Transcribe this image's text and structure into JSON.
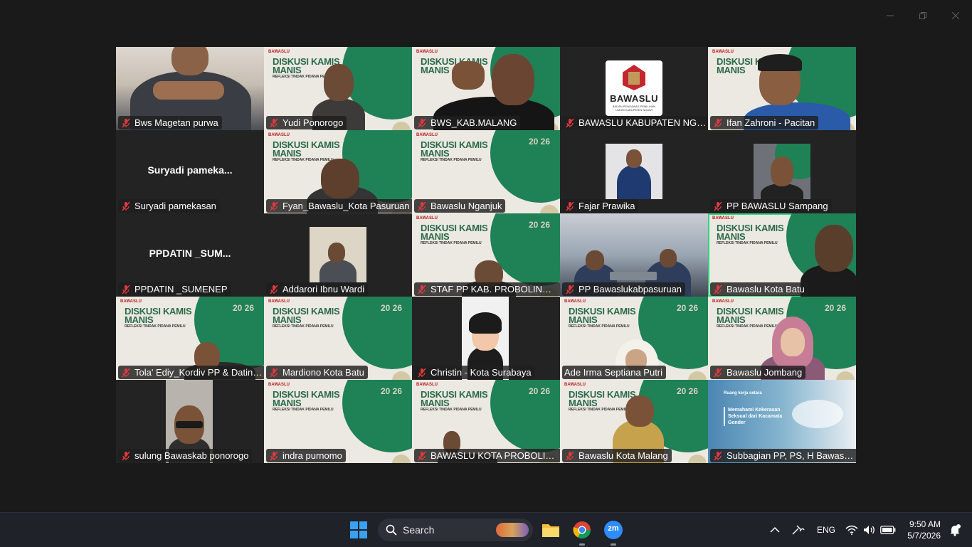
{
  "window": {
    "controls": [
      "minimize",
      "restore",
      "close"
    ]
  },
  "banner": {
    "logo": "BAWASLU",
    "title_line1": "DISKUSI KAMIS",
    "title_line2": "MANIS",
    "subtitle": "REFLEKSI TINDAK PIDANA PEMILU",
    "year": "20 26"
  },
  "logo_tile": {
    "name": "BAWASLU",
    "sub": "BADAN PENGAWAS PEMILIHAN UMUM KABUPATEN NGAWI"
  },
  "participants": [
    {
      "name": "Bws Magetan purwa"
    },
    {
      "name": "Yudi Ponorogo"
    },
    {
      "name": "BWS_KAB.MALANG"
    },
    {
      "name": "BAWASLU KABUPATEN NGAWI"
    },
    {
      "name": "Ifan Zahroni - Pacitan"
    },
    {
      "name": "Suryadi pamekasan",
      "big": "Suryadi  pameka..."
    },
    {
      "name": "Fyan_Bawaslu_Kota Pasuruan"
    },
    {
      "name": "Bawaslu Nganjuk"
    },
    {
      "name": "Fajar Prawika"
    },
    {
      "name": "PP BAWASLU Sampang"
    },
    {
      "name": "PPDATIN _SUMENEP",
      "big": "PPDATIN  _SUM..."
    },
    {
      "name": "Addarori Ibnu Wardi"
    },
    {
      "name": "STAF PP KAB. PROBOLINGGO"
    },
    {
      "name": "PP Bawaslukabpasuruan"
    },
    {
      "name": "Bawaslu Kota Batu"
    },
    {
      "name": "Tola' Ediy_Kordiv PP & Datin_..."
    },
    {
      "name": "Mardiono Kota Batu"
    },
    {
      "name": "Christin - Kota Surabaya"
    },
    {
      "name": "Ade Irma Septiana Putri"
    },
    {
      "name": "Bawaslu Jombang"
    },
    {
      "name": "sulung Bawaskab ponorogo"
    },
    {
      "name": "indra purnomo"
    },
    {
      "name": "BAWASLU KOTA PROBOLINGGO"
    },
    {
      "name": "Bawaslu Kota Malang"
    },
    {
      "name": "Subbagian PP, PS, H Bawaslu ..."
    }
  ],
  "presentation": {
    "line1": "Ruang kerja setara",
    "line2": "Memahami Kekerasan Seksual dari Kacamata Gender"
  },
  "taskbar": {
    "search_label": "Search",
    "apps": [
      "file-explorer",
      "chrome",
      "zoom"
    ],
    "zoom_label": "zm",
    "language": "ENG",
    "time": "9:50 AM",
    "date": "5/7/2026"
  },
  "colors": {
    "accent_green": "#2fd67c",
    "banner_green": "#1f8156",
    "mute_red": "#e0383e"
  }
}
